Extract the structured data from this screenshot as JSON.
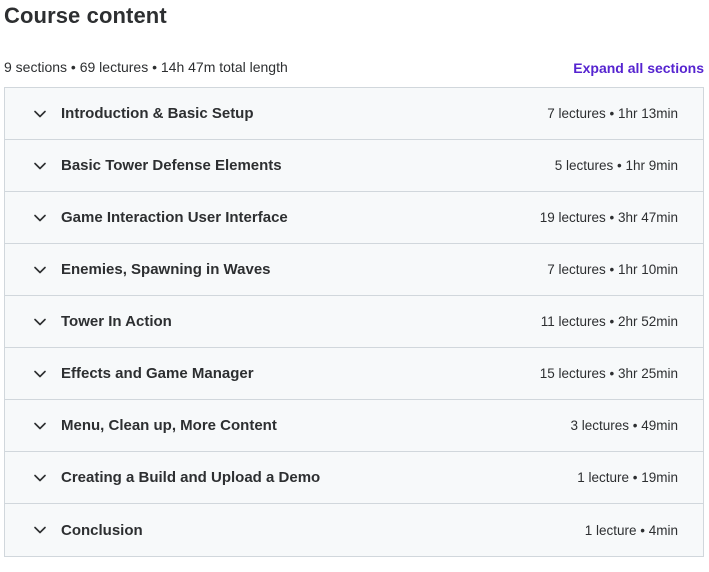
{
  "header": {
    "title": "Course content",
    "summary": "9 sections • 69 lectures • 14h 47m total length",
    "expand_all_label": "Expand all sections"
  },
  "colors": {
    "accent": "#5624d0",
    "section_bg": "#f7f9fa",
    "border": "#d1d7dc",
    "text": "#2d2f31"
  },
  "sections": [
    {
      "title": "Introduction & Basic Setup",
      "meta": "7 lectures • 1hr 13min",
      "icon": "chevron-down-icon"
    },
    {
      "title": "Basic Tower Defense Elements",
      "meta": "5 lectures • 1hr 9min",
      "icon": "chevron-down-icon"
    },
    {
      "title": "Game Interaction User Interface",
      "meta": "19 lectures • 3hr 47min",
      "icon": "chevron-down-icon"
    },
    {
      "title": "Enemies, Spawning in Waves",
      "meta": "7 lectures • 1hr 10min",
      "icon": "chevron-down-icon"
    },
    {
      "title": "Tower In Action",
      "meta": "11 lectures • 2hr 52min",
      "icon": "chevron-down-icon"
    },
    {
      "title": "Effects and Game Manager",
      "meta": "15 lectures • 3hr 25min",
      "icon": "chevron-down-icon"
    },
    {
      "title": "Menu, Clean up, More Content",
      "meta": "3 lectures • 49min",
      "icon": "chevron-down-icon"
    },
    {
      "title": "Creating a Build and Upload a Demo",
      "meta": "1 lecture • 19min",
      "icon": "chevron-down-icon"
    },
    {
      "title": "Conclusion",
      "meta": "1 lecture • 4min",
      "icon": "chevron-down-icon"
    }
  ]
}
